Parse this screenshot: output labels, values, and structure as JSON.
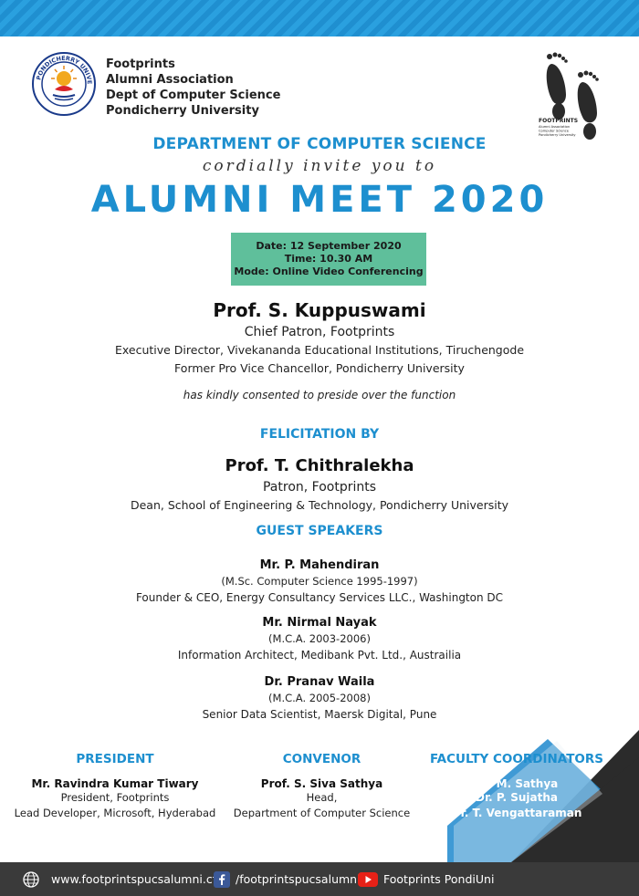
{
  "header": {
    "org_lines": [
      "Footprints",
      "Alumni Association",
      "Dept of Computer Science",
      "Pondicherry University"
    ],
    "seal_text": "PONDICHERRY UNIVERSITY",
    "logo_text": "FOOTPRINTS",
    "logo_sub": [
      "Alumni Association",
      "Computer Science",
      "Pondicherry University"
    ]
  },
  "invitation": {
    "department": "DEPARTMENT OF COMPUTER SCIENCE",
    "invite_line": "cordially invite you to",
    "title": "ALUMNI MEET 2020"
  },
  "event": {
    "date": "Date: 12 September 2020",
    "time": "Time: 10.30 AM",
    "mode": "Mode: Online Video Conferencing"
  },
  "chief_patron": {
    "name": "Prof. S. Kuppuswami",
    "role": "Chief Patron, Footprints",
    "line2": "Executive Director, Vivekananda Educational Institutions, Tiruchengode",
    "line3": "Former Pro Vice Chancellor, Pondicherry University",
    "consent": "has kindly consented to preside over the function"
  },
  "felicitation": {
    "heading": "FELICITATION BY",
    "name": "Prof. T. Chithralekha",
    "role": "Patron, Footprints",
    "line2": "Dean, School of Engineering & Technology, Pondicherry University"
  },
  "guest_speakers": {
    "heading": "GUEST SPEAKERS",
    "speakers": [
      {
        "name": "Mr. P. Mahendiran",
        "batch": "(M.Sc. Computer Science 1995-1997)",
        "affiliation": "Founder & CEO, Energy Consultancy Services LLC., Washington DC"
      },
      {
        "name": "Mr. Nirmal Nayak",
        "batch": "(M.C.A. 2003-2006)",
        "affiliation": "Information Architect, Medibank Pvt. Ltd., Austrailia"
      },
      {
        "name": "Dr. Pranav Waila",
        "batch": "(M.C.A. 2005-2008)",
        "affiliation": "Senior Data Scientist, Maersk Digital, Pune"
      }
    ]
  },
  "president": {
    "heading": "PRESIDENT",
    "name": "Mr. Ravindra Kumar Tiwary",
    "line1": "President, Footprints",
    "line2": "Lead Developer, Microsoft, Hyderabad"
  },
  "convenor": {
    "heading": "CONVENOR",
    "name": "Prof. S. Siva Sathya",
    "line1": "Head,",
    "line2": "Department of Computer Science"
  },
  "faculty": {
    "heading": "FACULTY COORDINATORS",
    "names": [
      "Dr. M. Sathya",
      "Dr. P. Sujatha",
      "Dr. T. Vengattaraman"
    ]
  },
  "footer": {
    "website": "www.footprintspucsalumni.cf",
    "facebook": "/footprintspucsalumni",
    "youtube": "Footprints PondiUni"
  },
  "colors": {
    "accent_blue": "#1d8fcf",
    "date_box": "#5fbf9b",
    "footer_bg": "#3a3a3a",
    "corner_dark": "#2b2b2b"
  },
  "icons": [
    "university-seal-icon",
    "footprints-logo-icon",
    "globe-icon",
    "facebook-icon",
    "youtube-icon"
  ]
}
